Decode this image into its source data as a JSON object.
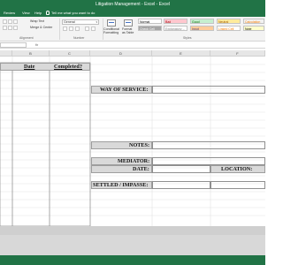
{
  "window": {
    "title": "Litigation Management - Excel    -    Excel"
  },
  "menu": {
    "items": [
      "Review",
      "View",
      "Help"
    ],
    "tell_me": "Tell me what you want to do"
  },
  "ribbon": {
    "alignment": {
      "wrap_text": "Wrap Text",
      "merge_center": "Merge & Center",
      "label": "Alignment"
    },
    "number": {
      "format": "General",
      "label": "Number"
    },
    "styles": {
      "conditional_formatting": "Conditional Formatting",
      "format_as_table": "Format as Table",
      "label": "Styles",
      "cells": [
        {
          "name": "Normal",
          "bg": "#ffffff",
          "fg": "#000000"
        },
        {
          "name": "Bad",
          "bg": "#ffc7ce",
          "fg": "#9c0006"
        },
        {
          "name": "Good",
          "bg": "#c6efce",
          "fg": "#006100"
        },
        {
          "name": "Neutral",
          "bg": "#ffeb9c",
          "fg": "#9c5700"
        },
        {
          "name": "Calculation",
          "bg": "#f2f2f2",
          "fg": "#fa7d00"
        },
        {
          "name": "Check Cell",
          "bg": "#a5a5a5",
          "fg": "#ffffff"
        },
        {
          "name": "Explanatory ...",
          "bg": "#ffffff",
          "fg": "#7f7f7f"
        },
        {
          "name": "Input",
          "bg": "#ffcc99",
          "fg": "#3f3f76"
        },
        {
          "name": "Linked Cell",
          "bg": "#ffffff",
          "fg": "#fa7d00"
        },
        {
          "name": "Note",
          "bg": "#ffffcc",
          "fg": "#000000"
        }
      ]
    }
  },
  "formula_bar": {
    "fx": "fx"
  },
  "grid": {
    "columns": [
      "B",
      "C",
      "D",
      "E",
      "F"
    ],
    "headers": {
      "date": "Date",
      "completed": "Completed?"
    },
    "labels": {
      "way_of_service": "WAY OF SERVICE:",
      "notes": "NOTES:",
      "mediator": "MEDIATOR:",
      "date": "DATE:",
      "location": "LOCATION:",
      "settled_impasse": "SETTLED / IMPASSE:"
    }
  },
  "colors": {
    "excel_green": "#217346",
    "label_shade": "#d9d9d9"
  }
}
